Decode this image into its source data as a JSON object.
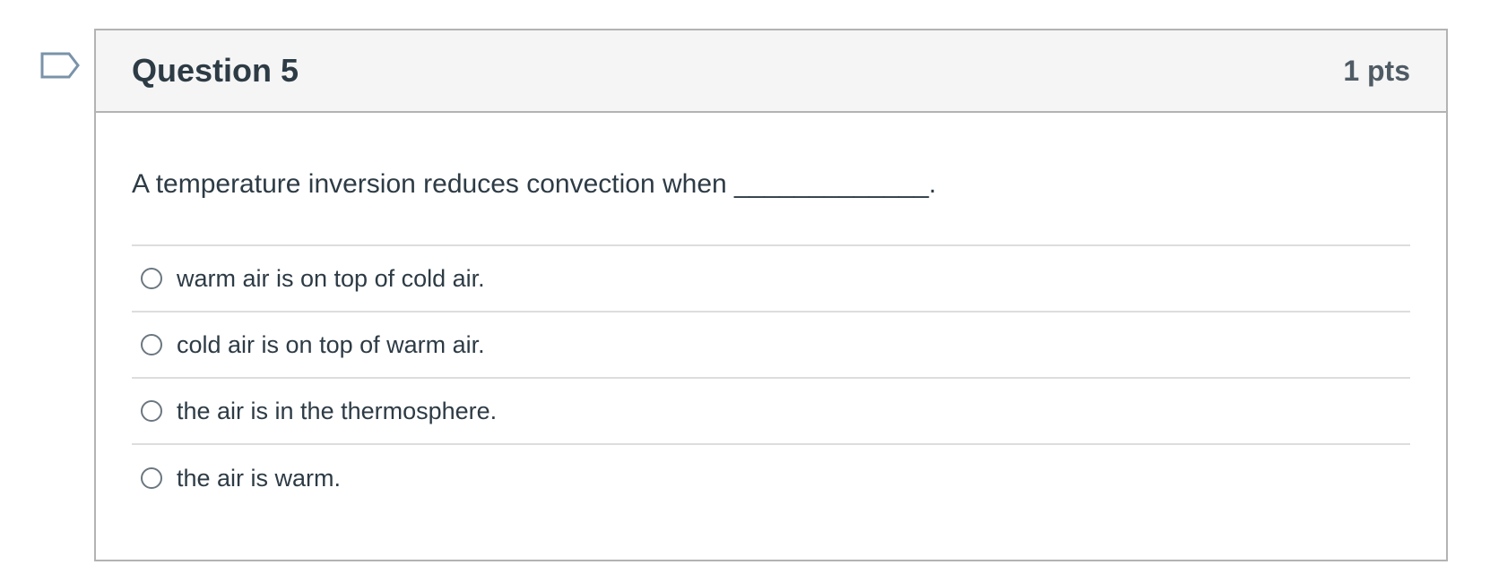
{
  "question": {
    "title": "Question 5",
    "points": "1 pts",
    "prompt": "A temperature inversion reduces convection when _____________."
  },
  "answers": [
    {
      "label": "warm air is on top of cold air."
    },
    {
      "label": "cold air is on top of warm air."
    },
    {
      "label": "the air is in the thermosphere."
    },
    {
      "label": "the air is warm."
    }
  ],
  "icons": {
    "flag": "flag-icon"
  },
  "colors": {
    "text": "#2d3b45",
    "header_bg": "#f5f5f5",
    "border": "#b3b3b3",
    "divider": "#dddddd",
    "flag_stroke": "#7a93a9"
  }
}
